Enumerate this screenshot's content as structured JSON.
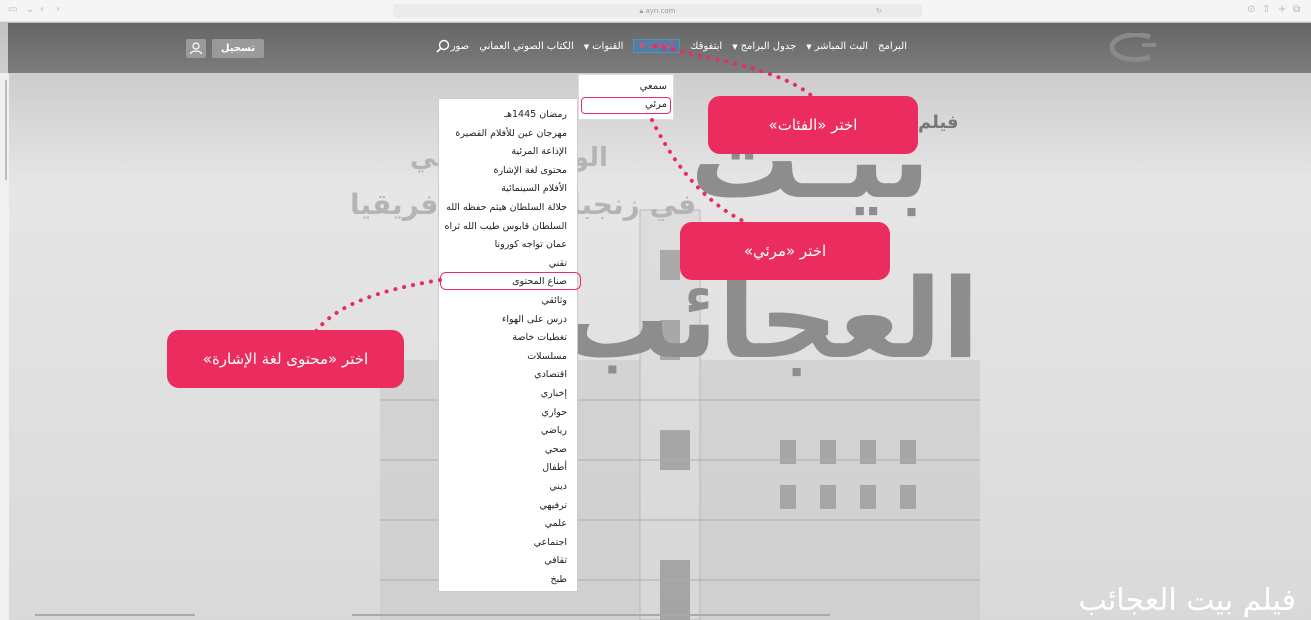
{
  "browser": {
    "url": "ayn.com"
  },
  "nav": {
    "items": [
      {
        "label": "البرامج",
        "caret": false
      },
      {
        "label": "البث المباشر",
        "caret": true
      },
      {
        "label": "جدول البرامج",
        "caret": true
      },
      {
        "label": "ابتفوقك",
        "caret": false
      },
      {
        "label": "الفئات",
        "caret": true,
        "active": true
      },
      {
        "label": "القنوات",
        "caret": true
      },
      {
        "label": "الكتاب الصوتي العماني",
        "caret": false
      },
      {
        "label": "صور",
        "caret": false
      }
    ],
    "register": "تسجيل"
  },
  "submenu": {
    "items": [
      "سمعي",
      "مرئي"
    ]
  },
  "dropdown": {
    "items": [
      "رمضان 1445هـ",
      "مهرجان عين للأفلام القصيرة",
      "الإذاعة المرئية",
      "محتوى لغة الإشارة",
      "الأفلام السينمائية",
      "جلالة السلطان هيثم حفظه الله",
      "السلطان قابوس طيب الله ثراه",
      "عمان تواجه كورونا",
      "تقني",
      "صناع المحتوى",
      "وثائقي",
      "درس على الهواء",
      "تغطيات خاصة",
      "مسلسلات",
      "اقتصادي",
      "إخباري",
      "حواري",
      "رياضي",
      "صحي",
      "أطفال",
      "ديني",
      "ترفيهي",
      "علمي",
      "اجتماعي",
      "ثقافي",
      "طبخ"
    ]
  },
  "hero": {
    "line1": "الوجود العمانـي",
    "line2": "في زنجبار وشرق إفريقيا",
    "film_word": "فيلم",
    "big1": "بيـت",
    "big2": "العجائب",
    "title": "فيلم بيت العجائب"
  },
  "callouts": {
    "categories": "اختر «الفئات»",
    "visual": "اختر «مرئي»",
    "sign": "اختر «محتوى لغة الإشارة»"
  },
  "colors": {
    "accent": "#ea2c5e",
    "header": "#6f6f6f"
  }
}
